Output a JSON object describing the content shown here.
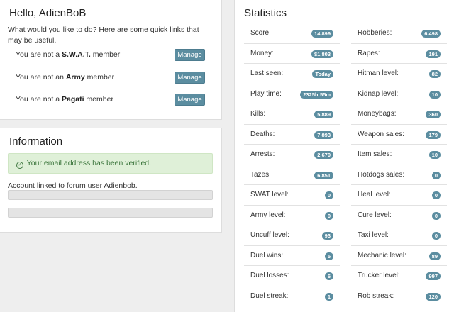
{
  "hello": {
    "title": "Hello, AdienBoB",
    "intro": "What would you like to do? Here are some quick links that may be useful.",
    "memberships": [
      {
        "prefix": "You are not a ",
        "group": "S.W.A.T.",
        "suffix": " member",
        "button": "Manage"
      },
      {
        "prefix": "You are not an ",
        "group": "Army",
        "suffix": " member",
        "button": "Manage"
      },
      {
        "prefix": "You are not a ",
        "group": "Pagati",
        "suffix": " member",
        "button": "Manage"
      }
    ]
  },
  "information": {
    "title": "Information",
    "verified": "Your email address has been verified.",
    "linked": "Account linked to forum user Adienbob."
  },
  "statistics": {
    "title": "Statistics",
    "left": [
      {
        "label": "Score:",
        "value": "14 899"
      },
      {
        "label": "Money:",
        "value": "$1 803"
      },
      {
        "label": "Last seen:",
        "value": "Today"
      },
      {
        "label": "Play time:",
        "value": "2325h:55m"
      },
      {
        "label": "Kills:",
        "value": "5 889"
      },
      {
        "label": "Deaths:",
        "value": "7 893"
      },
      {
        "label": "Arrests:",
        "value": "2 679"
      },
      {
        "label": "Tazes:",
        "value": "6 851"
      },
      {
        "label": "SWAT level:",
        "value": "0"
      },
      {
        "label": "Army level:",
        "value": "0"
      },
      {
        "label": "Uncuff level:",
        "value": "93"
      },
      {
        "label": "Duel wins:",
        "value": "5"
      },
      {
        "label": "Duel losses:",
        "value": "6"
      },
      {
        "label": "Duel streak:",
        "value": "1"
      }
    ],
    "right": [
      {
        "label": "Robberies:",
        "value": "6 498"
      },
      {
        "label": "Rapes:",
        "value": "191"
      },
      {
        "label": "Hitman level:",
        "value": "82"
      },
      {
        "label": "Kidnap level:",
        "value": "10"
      },
      {
        "label": "Moneybags:",
        "value": "360"
      },
      {
        "label": "Weapon sales:",
        "value": "179"
      },
      {
        "label": "Item sales:",
        "value": "10"
      },
      {
        "label": "Hotdogs sales:",
        "value": "0"
      },
      {
        "label": "Heal level:",
        "value": "0"
      },
      {
        "label": "Cure level:",
        "value": "0"
      },
      {
        "label": "Taxi level:",
        "value": "0"
      },
      {
        "label": "Mechanic level:",
        "value": "89"
      },
      {
        "label": "Trucker level:",
        "value": "997"
      },
      {
        "label": "Rob streak:",
        "value": "120"
      }
    ]
  },
  "colors": {
    "badge": "#5b8da0",
    "alert_bg": "#dff0d8",
    "alert_text": "#3c763d"
  }
}
